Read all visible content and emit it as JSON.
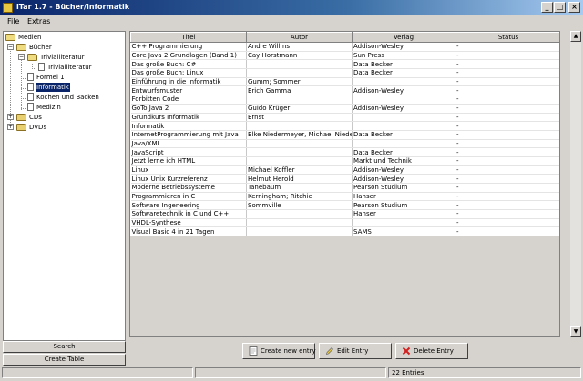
{
  "window": {
    "title": "iTar 1.7 - Bücher/Informatik",
    "controls": [
      "_",
      "□",
      "×"
    ]
  },
  "menubar": {
    "items": [
      "File",
      "Extras"
    ]
  },
  "tree": {
    "root": "Medien",
    "books": "Bücher",
    "trivial_folder": "Trivialliteratur",
    "trivial_doc": "Trivialliteratur",
    "formel": "Formel 1",
    "informatik": "Informatik",
    "kochen": "Kochen und Backen",
    "medizin": "Medizin",
    "cds": "CDs",
    "dvds": "DVDs"
  },
  "left_buttons": {
    "search": "Search",
    "create_table": "Create Table"
  },
  "table": {
    "columns": [
      "Titel",
      "Autor",
      "Verlag",
      "Status"
    ],
    "rows": [
      [
        "C++ Programmierung",
        "Andre Willms",
        "Addison-Wesley",
        "-"
      ],
      [
        "Core Java 2 Grundlagen (Band 1)",
        "Cay Horstmann",
        "Sun Press",
        "-"
      ],
      [
        "Das große Buch: C#",
        "",
        "Data Becker",
        "-"
      ],
      [
        "Das große Buch: Linux",
        "",
        "Data Becker",
        "-"
      ],
      [
        "Einführung in die Informatik",
        "Gumm; Sommer",
        "",
        "-"
      ],
      [
        "Entwurfsmuster",
        "Erich Gamma",
        "Addison-Wesley",
        "-"
      ],
      [
        "Forbitten Code",
        "",
        "",
        "-"
      ],
      [
        "GoTo Java 2",
        "Guido Krüger",
        "Addison-Wesley",
        "-"
      ],
      [
        "Grundkurs Informatik",
        "Ernst",
        "",
        "-"
      ],
      [
        "Informatik",
        "",
        "",
        "-"
      ],
      [
        "InternetProgrammierung mit Java",
        "Elke Niedermeyer, Michael Niede...",
        "Data Becker",
        "-"
      ],
      [
        "Java/XML",
        "",
        "",
        "-"
      ],
      [
        "JavaScript",
        "",
        "Data Becker",
        "-"
      ],
      [
        "Jetzt lerne ich HTML",
        "",
        "Markt und Technik",
        "-"
      ],
      [
        "Linux",
        "Michael Koffler",
        "Addison-Wesley",
        "-"
      ],
      [
        "Linux Unix Kurzreferenz",
        "Helmut Herold",
        "Addison-Wesley",
        "-"
      ],
      [
        "Moderne Betriebssysteme",
        "Tanebaum",
        "Pearson Studium",
        "-"
      ],
      [
        "Programmieren in C",
        "Kerningham; Ritchie",
        "Hanser",
        "-"
      ],
      [
        "Software Ingeneering",
        "Sommville",
        "Pearson Studium",
        "-"
      ],
      [
        "Softwaretechnik in C und C++",
        "",
        "Hanser",
        "-"
      ],
      [
        "VHDL-Synthese",
        "",
        "",
        "-"
      ],
      [
        "Visual Basic 4 in 21 Tagen",
        "",
        "SAMS",
        "-"
      ]
    ]
  },
  "actions": {
    "create": "Create new entry",
    "edit": "Edit Entry",
    "delete": "Delete Entry"
  },
  "status": {
    "entries": "22 Entries"
  },
  "colors": {
    "titlebar_start": "#0a246a",
    "titlebar_end": "#a6caf0",
    "selection": "#0a246a",
    "window_bg": "#d6d3ce"
  }
}
